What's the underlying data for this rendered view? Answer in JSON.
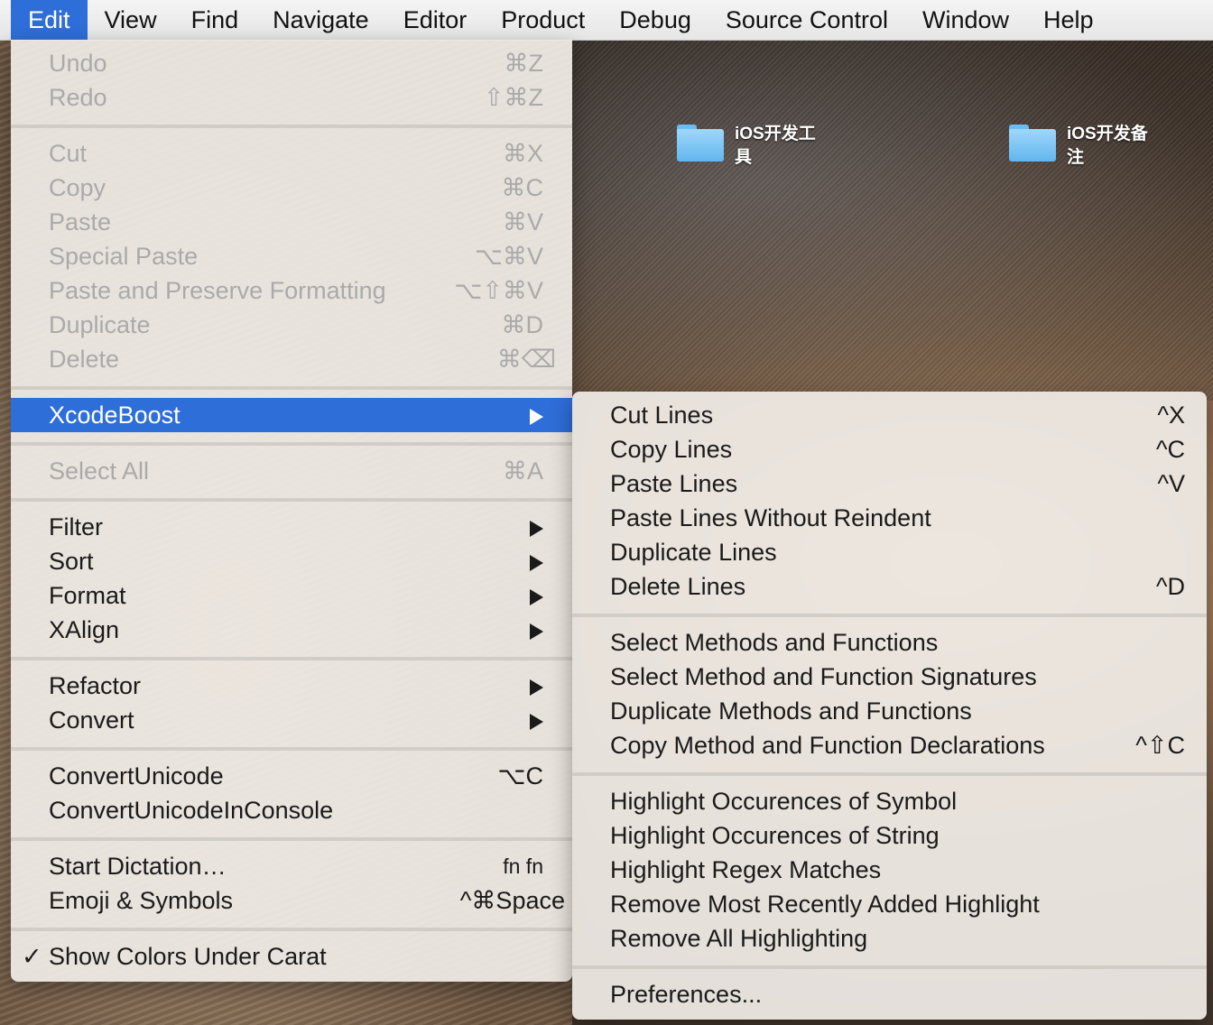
{
  "menubar": {
    "items": [
      "Edit",
      "View",
      "Find",
      "Navigate",
      "Editor",
      "Product",
      "Debug",
      "Source Control",
      "Window",
      "Help"
    ]
  },
  "desktop": {
    "icons": [
      {
        "line1": "iOS开发工",
        "line2": "具"
      },
      {
        "line1": "iOS开发备",
        "line2": "注"
      }
    ]
  },
  "edit_menu": {
    "undo": {
      "label": "Undo",
      "key": "⌘Z"
    },
    "redo": {
      "label": "Redo",
      "key": "⇧⌘Z"
    },
    "cut": {
      "label": "Cut",
      "key": "⌘X"
    },
    "copy": {
      "label": "Copy",
      "key": "⌘C"
    },
    "paste": {
      "label": "Paste",
      "key": "⌘V"
    },
    "special_paste": {
      "label": "Special Paste",
      "key": "⌥⌘V"
    },
    "paste_preserve": {
      "label": "Paste and Preserve Formatting",
      "key": "⌥⇧⌘V"
    },
    "duplicate": {
      "label": "Duplicate",
      "key": "⌘D"
    },
    "delete": {
      "label": "Delete",
      "key": "⌘⌫"
    },
    "xcodeboost": {
      "label": "XcodeBoost"
    },
    "select_all": {
      "label": "Select All",
      "key": "⌘A"
    },
    "filter": {
      "label": "Filter"
    },
    "sort": {
      "label": "Sort"
    },
    "format": {
      "label": "Format"
    },
    "xalign": {
      "label": "XAlign"
    },
    "refactor": {
      "label": "Refactor"
    },
    "convert": {
      "label": "Convert"
    },
    "convert_unicode": {
      "label": "ConvertUnicode",
      "key": "⌥C"
    },
    "convert_unicode_console": {
      "label": "ConvertUnicodeInConsole"
    },
    "start_dictation": {
      "label": "Start Dictation…",
      "key": "fn fn"
    },
    "emoji": {
      "label": "Emoji & Symbols",
      "key": "^⌘Space"
    },
    "show_colors": {
      "check": "✓",
      "label": "Show Colors Under Carat"
    }
  },
  "sub_menu": {
    "cut_lines": {
      "label": "Cut Lines",
      "key": "^X"
    },
    "copy_lines": {
      "label": "Copy Lines",
      "key": "^C"
    },
    "paste_lines": {
      "label": "Paste Lines",
      "key": "^V"
    },
    "paste_lines_no_reindent": {
      "label": "Paste Lines Without Reindent"
    },
    "duplicate_lines": {
      "label": "Duplicate Lines"
    },
    "delete_lines": {
      "label": "Delete Lines",
      "key": "^D"
    },
    "select_methods": {
      "label": "Select Methods and Functions"
    },
    "select_signatures": {
      "label": "Select Method and Function Signatures"
    },
    "duplicate_methods": {
      "label": "Duplicate Methods and Functions"
    },
    "copy_declarations": {
      "label": "Copy Method and Function Declarations",
      "key": "^⇧C"
    },
    "highlight_symbol": {
      "label": "Highlight Occurences of Symbol"
    },
    "highlight_string": {
      "label": "Highlight Occurences of String"
    },
    "highlight_regex": {
      "label": "Highlight Regex Matches"
    },
    "remove_recent_highlight": {
      "label": "Remove Most Recently Added Highlight"
    },
    "remove_all_highlighting": {
      "label": "Remove All Highlighting"
    },
    "preferences": {
      "label": "Preferences..."
    }
  },
  "colors": {
    "selection": "#2e6ed8",
    "folder": "#62b6ee"
  }
}
